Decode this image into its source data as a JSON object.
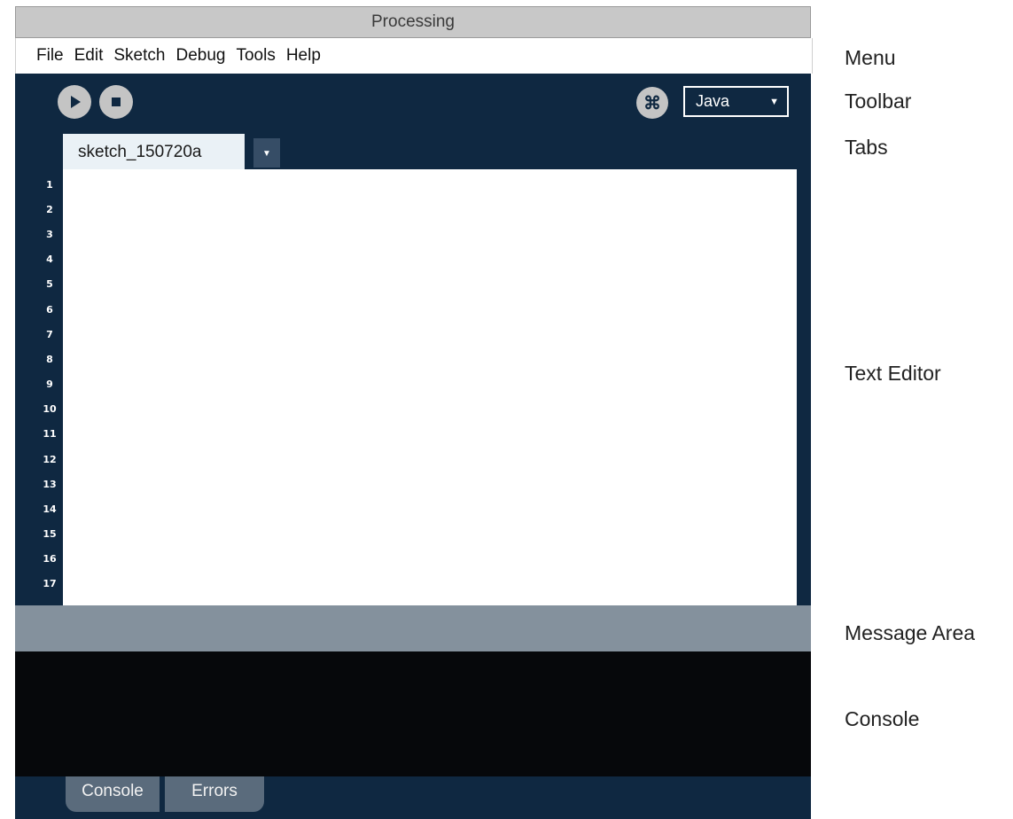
{
  "window": {
    "title": "Processing"
  },
  "menu": [
    "File",
    "Edit",
    "Sketch",
    "Debug",
    "Tools",
    "Help"
  ],
  "toolbar": {
    "mode": "Java"
  },
  "tabs": [
    {
      "label": "sketch_150720a"
    }
  ],
  "editor": {
    "line_numbers": [
      "1",
      "2",
      "3",
      "4",
      "5",
      "6",
      "7",
      "8",
      "9",
      "10",
      "11",
      "12",
      "13",
      "14",
      "15",
      "16",
      "17"
    ]
  },
  "bottom_tabs": [
    "Console",
    "Errors"
  ],
  "annotations": {
    "menu": "Menu",
    "toolbar": "Toolbar",
    "tabs": "Tabs",
    "text_editor": "Text Editor",
    "message_area": "Message Area",
    "console": "Console"
  }
}
